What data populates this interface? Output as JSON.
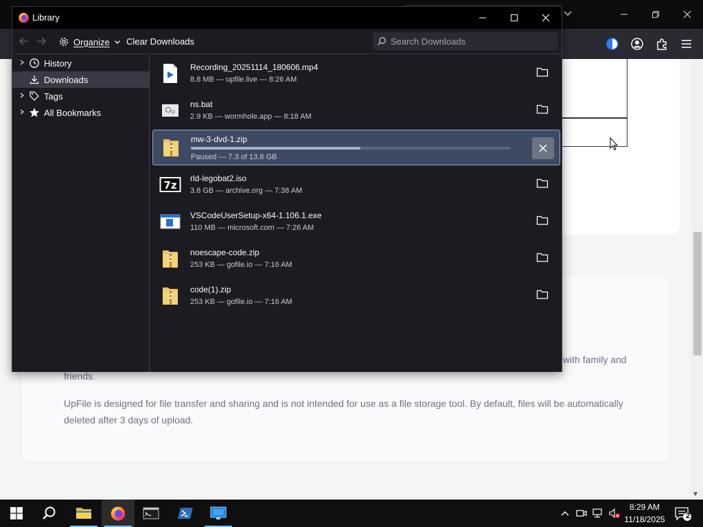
{
  "window": {
    "title": "Library"
  },
  "toolbar": {
    "organize_label": "Organize",
    "clear_label": "Clear Downloads",
    "search_placeholder": "Search Downloads"
  },
  "sidebar": {
    "items": [
      {
        "label": "History",
        "icon": "history-clock-icon",
        "expandable": true,
        "selected": false
      },
      {
        "label": "Downloads",
        "icon": "download-arrow-icon",
        "expandable": false,
        "selected": true
      },
      {
        "label": "Tags",
        "icon": "tag-icon",
        "expandable": true,
        "selected": false
      },
      {
        "label": "All Bookmarks",
        "icon": "star-icon",
        "expandable": true,
        "selected": false
      }
    ]
  },
  "downloads": [
    {
      "name": "Recording_20251114_180606.mp4",
      "status": "8.8 MB — upfile.live — 8:26 AM",
      "icon": "video-file-icon"
    },
    {
      "name": "ns.bat",
      "status": "2.9 KB — wormhole.app — 8:18 AM",
      "icon": "batch-file-icon"
    },
    {
      "name": "mw-3-dvd-1.zip",
      "status": "Paused — 7.3 of 13.8 GB",
      "icon": "zip-file-icon",
      "progress": 0.53,
      "paused": true
    },
    {
      "name": "rld-legobat2.iso",
      "status": "3.8 GB — archive.org — 7:38 AM",
      "icon": "7zip-file-icon"
    },
    {
      "name": "VSCodeUserSetup-x64-1.106.1.exe",
      "status": "110 MB — microsoft.com — 7:26 AM",
      "icon": "exe-file-icon"
    },
    {
      "name": "noescape-code.zip",
      "status": "253 KB — gofile.io — 7:16 AM",
      "icon": "zip-file-icon"
    },
    {
      "name": "code(1).zip",
      "status": "253 KB — gofile.io — 7:16 AM",
      "icon": "zip-file-icon"
    }
  ],
  "background_page": {
    "fragment_line": "with family and",
    "paragraph1_end": "friends.",
    "paragraph2": "UpFile is designed for file transfer and sharing and is not intended for use as a file storage tool. By default, files will be automatically deleted after 3 days of upload."
  },
  "taskbar": {
    "time": "8:29 AM",
    "date": "11/18/2025",
    "notification_count": "2"
  },
  "colors": {
    "library_bg": "#1c1b22",
    "selection": "#3e4a62",
    "accent": "#76b9ed"
  }
}
